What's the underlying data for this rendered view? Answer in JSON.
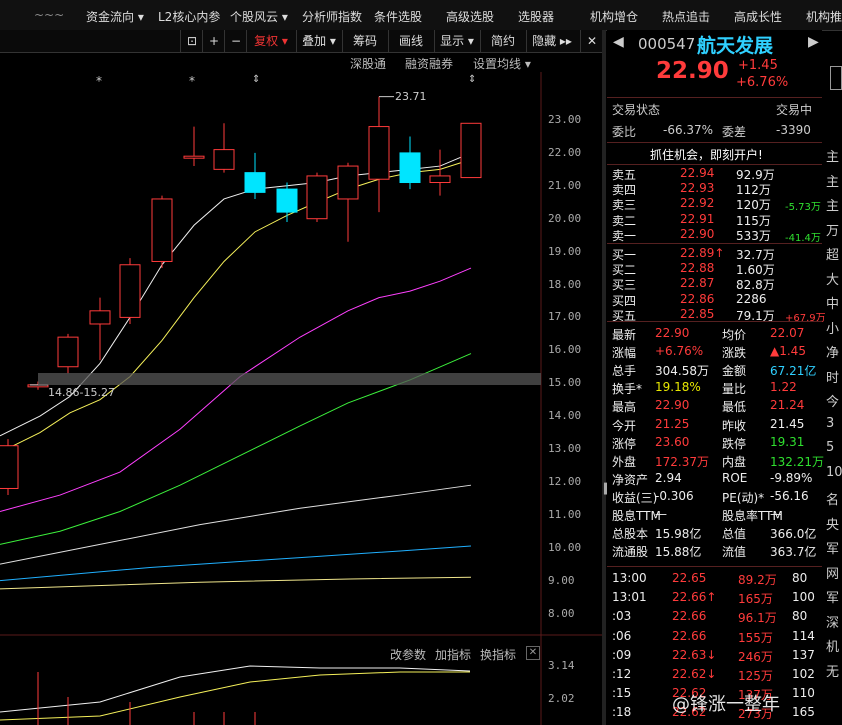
{
  "menu": {
    "items": [
      "资金流向 ▾",
      "L2核心内参",
      "个股风云 ▾",
      "分析师指数",
      "条件选股",
      "高级选股",
      "选股器",
      "机构增仓",
      "热点追击",
      "高成长性",
      "机构推"
    ]
  },
  "toolbar": {
    "plus": "+",
    "minus": "−",
    "fuquan": "复权 ▾",
    "diejia": "叠加 ▾",
    "chouma": "筹码",
    "huaxian": "画线",
    "xianshi": "显示 ▾",
    "jianyue": "简约",
    "yincang": "隐藏 ▸▸"
  },
  "subbar": {
    "shengu": "深股通",
    "rongzi": "融资融券",
    "junxian": "设置均线 ▾"
  },
  "chart": {
    "price_ticks": [
      "23.00",
      "22.00",
      "21.00",
      "20.00",
      "19.00",
      "18.00",
      "17.00",
      "16.00",
      "15.00",
      "14.00",
      "13.00",
      "12.00",
      "11.00",
      "10.00",
      "9.00",
      "8.00"
    ],
    "high_label": "23.71",
    "support_label": "14.86-15.27",
    "indicator_btns": [
      "改参数",
      "加指标",
      "换指标"
    ],
    "indicator_ticks": [
      "3.14",
      "2.02"
    ]
  },
  "chart_data": {
    "type": "candlestick",
    "ylim": [
      7.5,
      23.8
    ],
    "candles": [
      {
        "o": 11.8,
        "c": 13.1,
        "h": 13.3,
        "l": 11.6,
        "up": true
      },
      {
        "o": 14.95,
        "c": 14.95,
        "h": 15.05,
        "l": 14.8,
        "up": true
      },
      {
        "o": 15.5,
        "c": 16.4,
        "h": 16.5,
        "l": 15.3,
        "up": true
      },
      {
        "o": 16.8,
        "c": 17.2,
        "h": 17.6,
        "l": 15.7,
        "up": true
      },
      {
        "o": 17.0,
        "c": 18.6,
        "h": 18.8,
        "l": 16.8,
        "up": true
      },
      {
        "o": 18.7,
        "c": 20.6,
        "h": 20.7,
        "l": 18.5,
        "up": true
      },
      {
        "o": 21.9,
        "c": 21.9,
        "h": 22.8,
        "l": 21.6,
        "up": true
      },
      {
        "o": 21.5,
        "c": 22.1,
        "h": 22.9,
        "l": 21.4,
        "up": true
      },
      {
        "o": 21.4,
        "c": 20.8,
        "h": 22.0,
        "l": 20.6,
        "up": false
      },
      {
        "o": 20.9,
        "c": 20.2,
        "h": 21.1,
        "l": 19.9,
        "up": false
      },
      {
        "o": 20.0,
        "c": 21.3,
        "h": 21.4,
        "l": 19.9,
        "up": true
      },
      {
        "o": 20.6,
        "c": 21.6,
        "h": 21.7,
        "l": 19.3,
        "up": true
      },
      {
        "o": 21.2,
        "c": 22.8,
        "h": 23.71,
        "l": 20.2,
        "up": true
      },
      {
        "o": 22.0,
        "c": 21.1,
        "h": 22.5,
        "l": 20.9,
        "up": false
      },
      {
        "o": 21.1,
        "c": 21.3,
        "h": 22.1,
        "l": 20.7,
        "up": true
      },
      {
        "o": 21.25,
        "c": 22.9,
        "h": 22.9,
        "l": 21.24,
        "up": true
      }
    ]
  },
  "quote": {
    "code": "000547",
    "name": "航天发展",
    "price": "22.90",
    "chg": "+1.45",
    "pct": "+6.76%",
    "status_label": "交易状态",
    "status_value": "交易中",
    "weibi_label": "委比",
    "weibi": "-66.37%",
    "weicha_label": "委差",
    "weicha": "-3390",
    "banner": "抓住机会，即刻开户!"
  },
  "book": {
    "asks": [
      {
        "label": "卖五",
        "price": "22.94",
        "vol": "92.9万",
        "chg": ""
      },
      {
        "label": "卖四",
        "price": "22.93",
        "vol": "112万",
        "chg": ""
      },
      {
        "label": "卖三",
        "price": "22.92",
        "vol": "120万",
        "chg": "-5.73万"
      },
      {
        "label": "卖二",
        "price": "22.91",
        "vol": "115万",
        "chg": ""
      },
      {
        "label": "卖一",
        "price": "22.90",
        "vol": "533万",
        "chg": "-41.4万"
      }
    ],
    "bids": [
      {
        "label": "买一",
        "price": "22.89↑",
        "vol": "32.7万",
        "chg": ""
      },
      {
        "label": "买二",
        "price": "22.88",
        "vol": "1.60万",
        "chg": ""
      },
      {
        "label": "买三",
        "price": "22.87",
        "vol": "82.8万",
        "chg": ""
      },
      {
        "label": "买四",
        "price": "22.86",
        "vol": "2286",
        "chg": ""
      },
      {
        "label": "买五",
        "price": "22.85",
        "vol": "79.1万",
        "chg": "+67.9万"
      }
    ]
  },
  "stats": [
    {
      "l1": "最新",
      "v1": "22.90",
      "c1": "red",
      "l2": "均价",
      "v2": "22.07",
      "c2": "red"
    },
    {
      "l1": "涨幅",
      "v1": "+6.76%",
      "c1": "red",
      "l2": "涨跌",
      "v2": "▲1.45",
      "c2": "red"
    },
    {
      "l1": "总手",
      "v1": "304.58万",
      "c1": "wht",
      "l2": "金额",
      "v2": "67.21亿",
      "c2": "cyan"
    },
    {
      "l1": "换手*",
      "v1": "19.18%",
      "c1": "yel",
      "l2": "量比",
      "v2": "1.22",
      "c2": "red"
    },
    {
      "l1": "最高",
      "v1": "22.90",
      "c1": "red",
      "l2": "最低",
      "v2": "21.24",
      "c2": "red"
    },
    {
      "l1": "今开",
      "v1": "21.25",
      "c1": "red",
      "l2": "昨收",
      "v2": "21.45",
      "c2": "wht"
    },
    {
      "l1": "涨停",
      "v1": "23.60",
      "c1": "red",
      "l2": "跌停",
      "v2": "19.31",
      "c2": "grn"
    },
    {
      "l1": "外盘",
      "v1": "172.37万",
      "c1": "red",
      "l2": "内盘",
      "v2": "132.21万",
      "c2": "grn"
    },
    {
      "l1": "净资产",
      "v1": "2.94",
      "c1": "wht",
      "l2": "ROE",
      "v2": "-9.89%",
      "c2": "wht"
    },
    {
      "l1": "收益(三)",
      "v1": "-0.306",
      "c1": "wht",
      "l2": "PE(动)*",
      "v2": "-56.16",
      "c2": "wht"
    },
    {
      "l1": "股息TTM",
      "v1": "—",
      "c1": "wht",
      "l2": "股息率TTM",
      "v2": "—",
      "c2": "wht"
    },
    {
      "l1": "总股本",
      "v1": "15.98亿",
      "c1": "wht",
      "l2": "总值",
      "v2": "366.0亿",
      "c2": "wht"
    },
    {
      "l1": "流通股",
      "v1": "15.88亿",
      "c1": "wht",
      "l2": "流值",
      "v2": "363.7亿",
      "c2": "wht"
    }
  ],
  "ticks": [
    {
      "t": "13:00",
      "p": "22.65",
      "v": "89.2万",
      "n": "80"
    },
    {
      "t": "13:01",
      "p": "22.66↑",
      "v": "165万",
      "n": "100"
    },
    {
      "t": ":03",
      "p": "22.66",
      "v": "96.1万",
      "n": "80"
    },
    {
      "t": ":06",
      "p": "22.66",
      "v": "155万",
      "n": "114"
    },
    {
      "t": ":09",
      "p": "22.63↓",
      "v": "246万",
      "n": "137"
    },
    {
      "t": ":12",
      "p": "22.62↓",
      "v": "125万",
      "n": "102"
    },
    {
      "t": ":15",
      "p": "22.62",
      "v": "137万",
      "n": "110"
    },
    {
      "t": ":18",
      "p": "22.62",
      "v": "273万",
      "n": "165"
    }
  ],
  "edge_chars": [
    "主",
    "主",
    "主",
    "万",
    "超",
    "大",
    "中",
    "小",
    "净",
    "时",
    "今",
    "3",
    "5",
    "10",
    "名",
    "央",
    "军",
    "网",
    "军",
    "深",
    "机",
    "无"
  ],
  "watermark": "@锋涨一整年"
}
